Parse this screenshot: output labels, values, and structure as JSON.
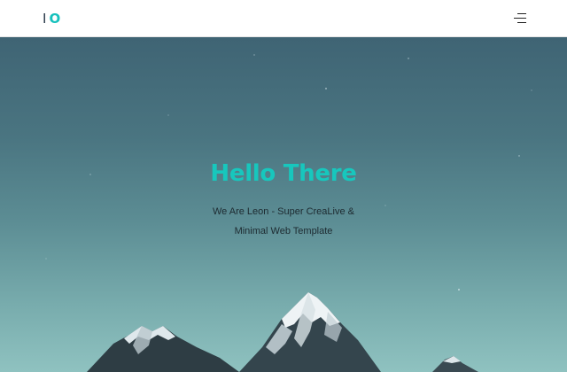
{
  "header": {
    "logo": {
      "letter1": "I",
      "letter2": "O"
    },
    "menu_icon": "hamburger-menu-icon"
  },
  "hero": {
    "title": "Hello There",
    "subtitle_line1": "We Are Leon - Super CreaLive &",
    "subtitle_line2": "Minimal Web Template"
  },
  "colors": {
    "accent": "#17c7bd",
    "sky_top": "#3f6474",
    "sky_bottom": "#8fc2c0"
  }
}
